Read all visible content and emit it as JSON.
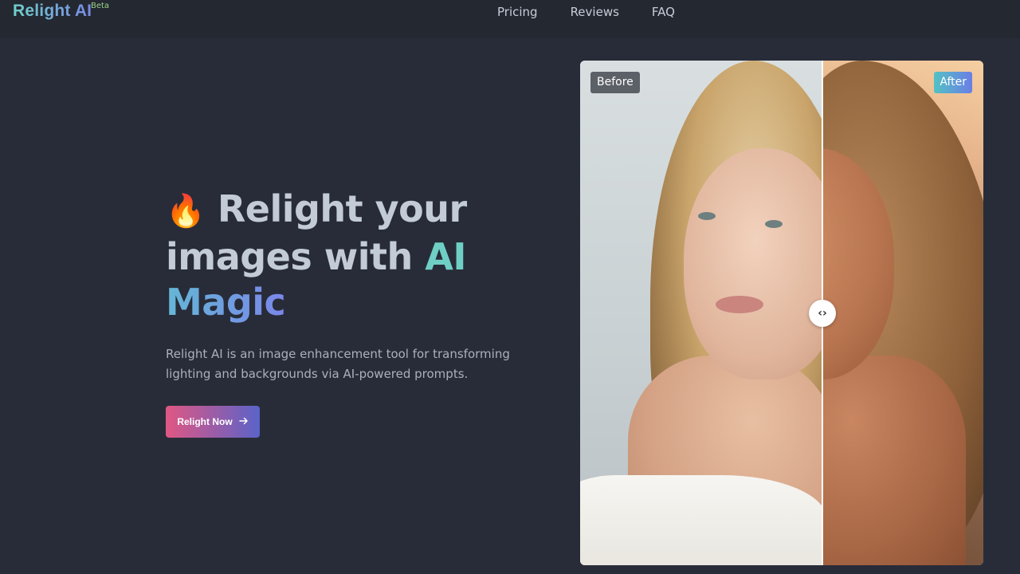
{
  "header": {
    "logo": "Relight AI",
    "badge": "Beta",
    "nav": [
      {
        "label": "Pricing"
      },
      {
        "label": "Reviews"
      },
      {
        "label": "FAQ"
      }
    ]
  },
  "hero": {
    "emoji": "🔥",
    "title_part1": "Relight your images with",
    "title_accent": "AI",
    "title_accent2": "Magic",
    "description": "Relight AI is an image enhancement tool for transforming lighting and backgrounds via AI-powered prompts.",
    "cta_label": "Relight Now",
    "cta_icon": "arrow-right-icon"
  },
  "comparison": {
    "before_label": "Before",
    "after_label": "After",
    "handle_glyph": "‹›"
  },
  "colors": {
    "background": "#282c38",
    "accent_teal": "#6fcfc5",
    "accent_purple": "#7a86ea",
    "cta_start": "#e05783",
    "cta_end": "#5a63c9"
  }
}
